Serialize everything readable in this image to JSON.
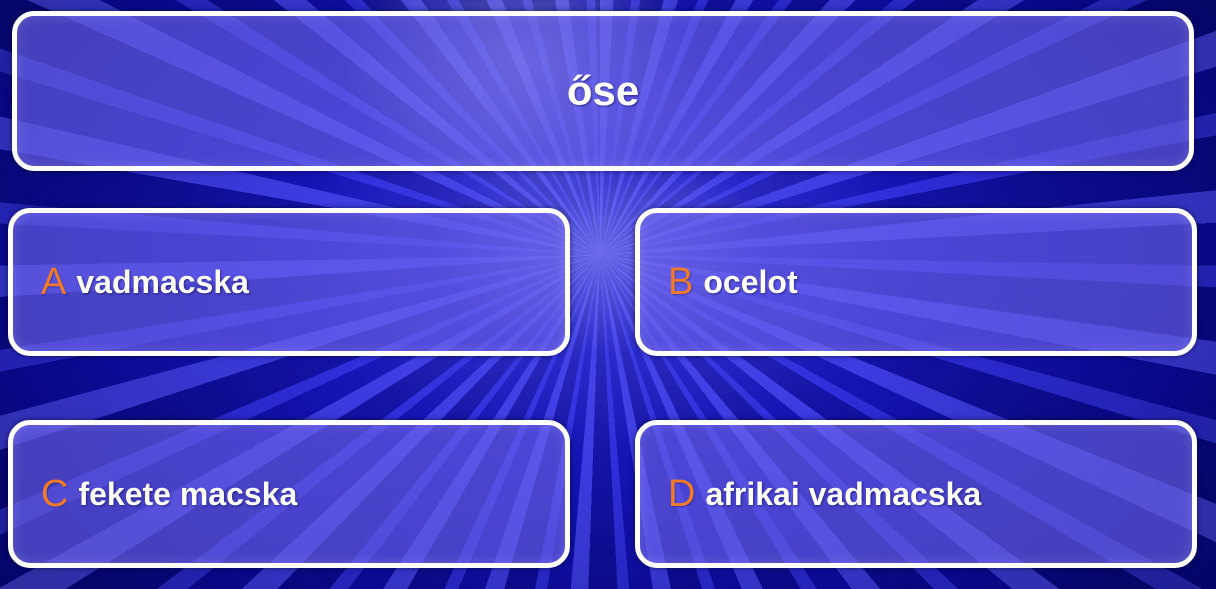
{
  "question": {
    "text": "őse"
  },
  "answers": [
    {
      "letter": "A",
      "text": "vadmacska"
    },
    {
      "letter": "B",
      "text": "ocelot"
    },
    {
      "letter": "C",
      "text": "fekete macska"
    },
    {
      "letter": "D",
      "text": "afrikai vadmacska"
    }
  ],
  "colors": {
    "letter_accent": "#f07a2a",
    "box_border": "#ffffff",
    "box_fill": "#6e64eb",
    "background": "#1a1ad0"
  }
}
